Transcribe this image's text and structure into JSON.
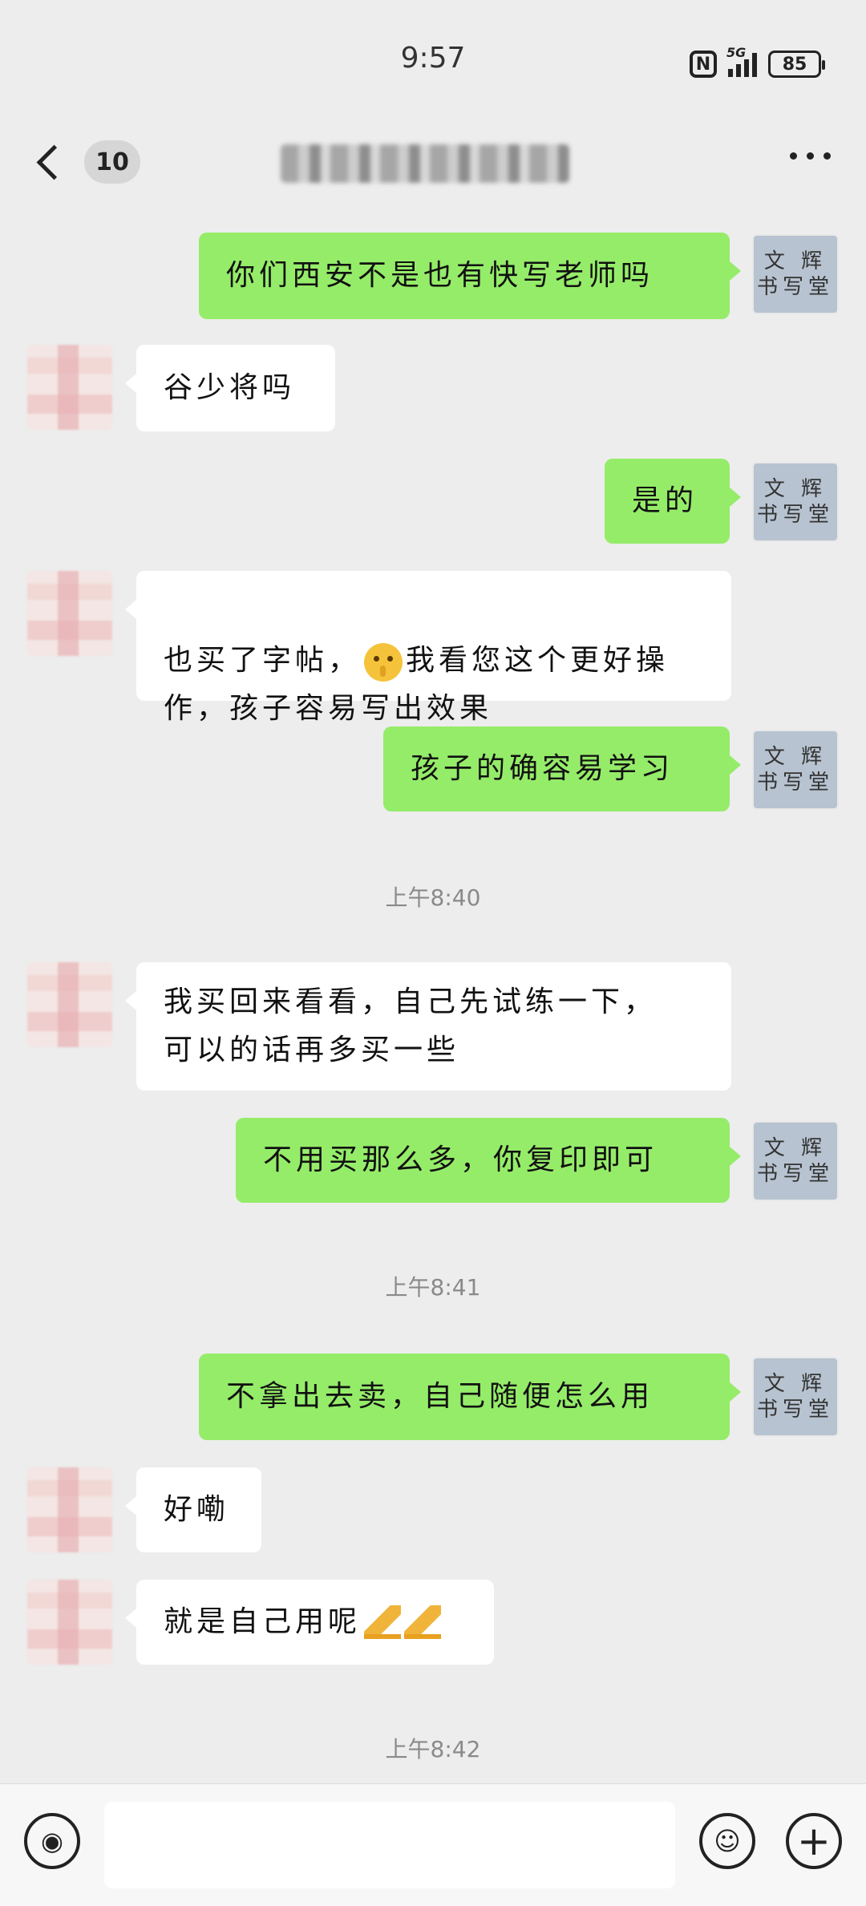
{
  "status_bar": {
    "time": "9:57",
    "network": "5G",
    "battery": "85",
    "nfc": "N"
  },
  "nav": {
    "unread_count": "10",
    "title": ""
  },
  "messages": [
    {
      "id": "m1",
      "side": "sent",
      "text": "你们西安不是也有快写老师吗"
    },
    {
      "id": "m2",
      "side": "recv",
      "text": "谷少将吗"
    },
    {
      "id": "m3",
      "side": "sent",
      "text": "是的"
    },
    {
      "id": "m4",
      "side": "recv",
      "text_before_emoji": "也买了字帖，",
      "text_after_emoji": "我看您这个更好操\n作，孩子容易写出效果",
      "emoji": "shushing-face"
    },
    {
      "id": "m5",
      "side": "sent",
      "text": "孩子的确容易学习"
    },
    {
      "id": "t1",
      "type": "time",
      "text": "上午8:40"
    },
    {
      "id": "m6",
      "side": "recv",
      "text": "我买回来看看，自己先试练一下，\n可以的话再多买一些"
    },
    {
      "id": "m7",
      "side": "sent",
      "text": "不用买那么多，你复印即可"
    },
    {
      "id": "t2",
      "type": "time",
      "text": "上午8:41"
    },
    {
      "id": "m8",
      "side": "sent",
      "text": "不拿出去卖，自己随便怎么用"
    },
    {
      "id": "m9",
      "side": "recv",
      "text": "好嘞"
    },
    {
      "id": "m10",
      "side": "recv",
      "text": "就是自己用呢",
      "emoji": "folded-hands"
    },
    {
      "id": "t3",
      "type": "time",
      "text": "上午8:42"
    }
  ],
  "self_avatar": {
    "text": "文 辉\n书写堂"
  },
  "colors": {
    "sent_bubble": "#95ec69",
    "recv_bubble": "#ffffff",
    "background": "#ededed"
  },
  "input": {
    "placeholder": ""
  }
}
